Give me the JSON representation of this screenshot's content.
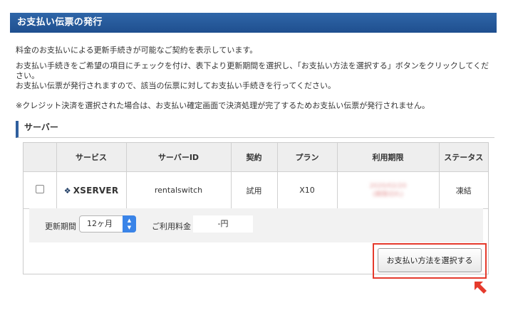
{
  "header": {
    "title": "お支払い伝票の発行"
  },
  "intro": {
    "line1": "料金のお支払いによる更新手続きが可能なご契約を表示しています。",
    "line2": "お支払い手続きをご希望の項目にチェックを付け、表下より更新期間を選択し、「お支払い方法を選択する」ボタンをクリックしてください。",
    "line3": "お支払い伝票が発行されますので、該当の伝票に対してお支払い手続きを行ってください。",
    "line4": "※クレジット決済を選択された場合は、お支払い確定画面で決済処理が完了するためお支払い伝票が発行されません。"
  },
  "section": {
    "title": "サーバー"
  },
  "table": {
    "headers": [
      "サービス",
      "サーバーID",
      "契約",
      "プラン",
      "利用期限",
      "ステータス"
    ],
    "row": {
      "service": "XSERVER",
      "server_id": "rentalswitch",
      "contract": "試用",
      "plan": "X10",
      "expiry_line1": "2020/02/20",
      "expiry_line2": "(期限切れ)",
      "status": "凍結"
    }
  },
  "renewal": {
    "period_label": "更新期間",
    "period_value": "12ヶ月",
    "fee_label": "ご利用料金",
    "fee_value": "-円"
  },
  "actions": {
    "pay_button": "お支払い方法を選択する"
  },
  "colors": {
    "header_bg": "#2f66a8",
    "accent_blue": "#3a84e8",
    "highlight_red": "#e53a2c"
  },
  "icons": {
    "logo_mark": "xserver-logo-icon",
    "pointer": "red-arrow-pointer-icon"
  }
}
